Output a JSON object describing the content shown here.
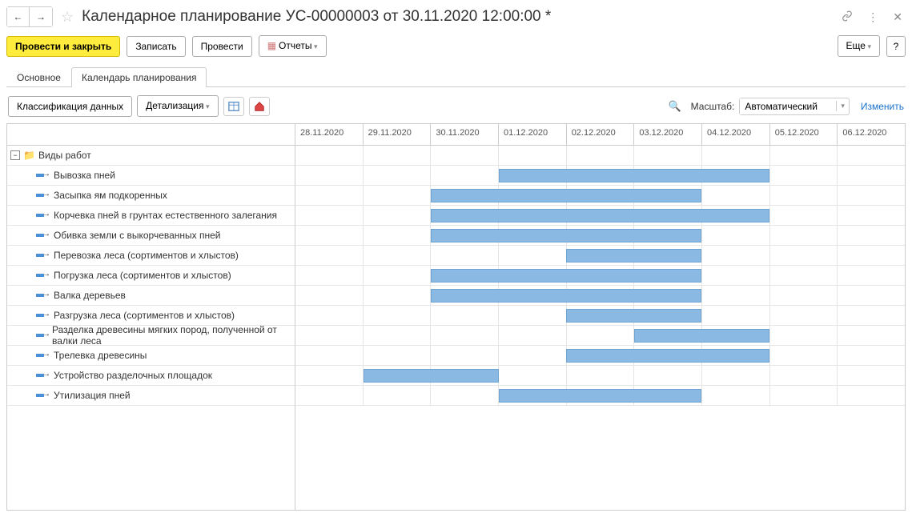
{
  "header": {
    "title": "Календарное планирование УС-00000003 от 30.11.2020 12:00:00 *"
  },
  "toolbar": {
    "post_and_close": "Провести и закрыть",
    "save": "Записать",
    "post": "Провести",
    "reports": "Отчеты",
    "more": "Еще",
    "help": "?"
  },
  "tabs": {
    "main": "Основное",
    "calendar": "Календарь планирования"
  },
  "second_toolbar": {
    "classify": "Классификация данных",
    "detail": "Детализация",
    "scale_label": "Масштаб:",
    "scale_value": "Автоматический",
    "change": "Изменить"
  },
  "dates": [
    "28.11.2020",
    "29.11.2020",
    "30.11.2020",
    "01.12.2020",
    "02.12.2020",
    "03.12.2020",
    "04.12.2020",
    "05.12.2020",
    "06.12.2020"
  ],
  "group": {
    "label": "Виды работ"
  },
  "tasks": [
    {
      "label": "Вывозка пней",
      "start": 3,
      "span": 4
    },
    {
      "label": "Засыпка ям подкоренных",
      "start": 2,
      "span": 4
    },
    {
      "label": "Корчевка пней в грунтах естественного залегания",
      "start": 2,
      "span": 5
    },
    {
      "label": "Обивка земли с выкорчеванных пней",
      "start": 2,
      "span": 4
    },
    {
      "label": "Перевозка леса (сортиментов и хлыстов)",
      "start": 4,
      "span": 2
    },
    {
      "label": "Погрузка леса (сортиментов и хлыстов)",
      "start": 2,
      "span": 4
    },
    {
      "label": "Валка деревьев",
      "start": 2,
      "span": 4
    },
    {
      "label": "Разгрузка леса (сортиментов и хлыстов)",
      "start": 4,
      "span": 2
    },
    {
      "label": "Разделка древесины мягких пород, полученной от валки леса",
      "start": 5,
      "span": 2
    },
    {
      "label": "Трелевка древесины",
      "start": 4,
      "span": 3
    },
    {
      "label": "Устройство разделочных площадок",
      "start": 1,
      "span": 2
    },
    {
      "label": "Утилизация пней",
      "start": 3,
      "span": 3
    }
  ]
}
